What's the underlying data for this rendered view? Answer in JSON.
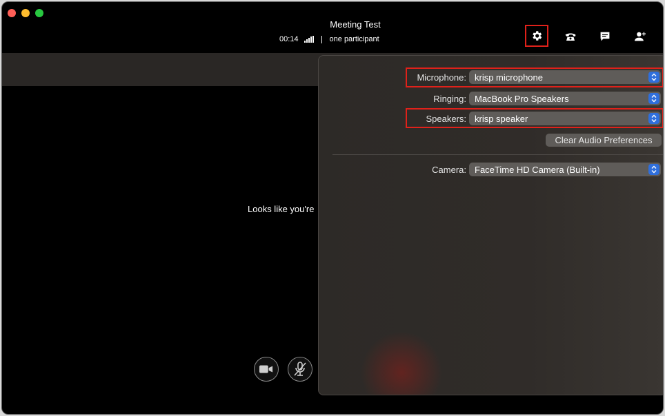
{
  "window": {
    "title": "Meeting Test"
  },
  "call": {
    "elapsed": "00:14",
    "participants": "one participant"
  },
  "toolbar": {
    "settings_icon": "gear-icon",
    "phone_icon": "phone-icon",
    "chat_icon": "chat-icon",
    "add_user_icon": "add-user-icon"
  },
  "main": {
    "empty_message": "Looks like you're"
  },
  "controls": {
    "video_icon": "camera-icon",
    "mic_icon": "mic-muted-icon"
  },
  "settings": {
    "microphone": {
      "label": "Microphone:",
      "value": "krisp microphone"
    },
    "ringing": {
      "label": "Ringing:",
      "value": "MacBook Pro Speakers"
    },
    "speakers": {
      "label": "Speakers:",
      "value": "krisp speaker"
    },
    "clear_button": "Clear Audio Preferences",
    "camera": {
      "label": "Camera:",
      "value": "FaceTime HD Camera (Built-in)"
    }
  },
  "colors": {
    "highlight": "#e0211a",
    "select_chevron": "#2f6fdc",
    "panel_bg": "#2d2a27"
  }
}
